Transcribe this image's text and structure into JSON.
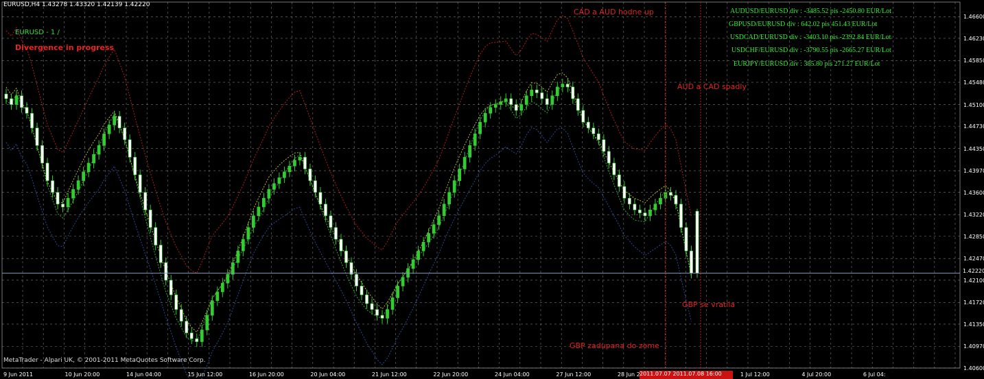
{
  "header": {
    "text": "EURUSD,H4  1.43278 1.43320 1.42139 1.42220"
  },
  "indicator": {
    "symbol_label": "EURUSD - 1 / ",
    "status": "Divergence in progress",
    "lines": [
      "AUDUSD/EURUSD div : -3485.52 pis -2450.80 EUR/Lot",
      "GBPUSD/EURUSD div : 642.02 pis 451.43 EUR/Lot",
      "USDCAD/EURUSD div : -3403.10 pis -2392.84 EUR/Lot",
      "USDCHF/EURUSD div : -3790.55 pis -2665.27 EUR/Lot",
      "EURJPY/EURUSD div : 385.80 pis 271.27 EUR/Lot"
    ]
  },
  "annotations": {
    "cad_aud_up": "CAD a AUD hodne up",
    "aud_cad_down": "AUD a CAD spadly",
    "gbp_back": "GBP se vratila",
    "gbp_down": "GBP zadupana do zeme"
  },
  "copyright": "MetaTrader - Alpari UK, © 2001-2011 MetaQuotes Software Corp.",
  "y_axis": [
    "1.46600",
    "1.46230",
    "1.45850",
    "1.45480",
    "1.45100",
    "1.44730",
    "1.44350",
    "1.43970",
    "1.43600",
    "1.43220",
    "1.42850",
    "1.42470",
    "1.42100",
    "1.41720",
    "1.41350",
    "1.40970",
    "1.40600"
  ],
  "current_price": "1.42220",
  "x_axis": [
    "9 Jun 2011",
    "10 Jun 20:00",
    "14 Jun 04:00",
    "15 Jun 12:00",
    "16 Jun 20:00",
    "20 Jun 04:00",
    "21 Jun 12:00",
    "22 Jun 20:00",
    "24 Jun 04:00",
    "27 Jun 12:00",
    "28 Jun 20:00",
    "30 Jun 04:00",
    "1 Jul 12:00",
    "4 Jul 20:00",
    "6 Jul 04:"
  ],
  "time_box": "2011.07.07 2011.07.08 16:00",
  "colors": {
    "background": "#000000",
    "grid": "#aaaaaa",
    "bull": "#ffffff",
    "bear": "#33cc33",
    "candle_border": "#33cc33",
    "div_text": "#33ee33",
    "annotation": "#dd2222",
    "price_line": "#8899bb"
  },
  "chart_data": {
    "type": "candlestick",
    "symbol": "EURUSD",
    "timeframe": "H4",
    "ylim": [
      1.406,
      1.4685
    ],
    "last": {
      "open": 1.43278,
      "high": 1.4332,
      "low": 1.42139,
      "close": 1.4222
    },
    "closes": [
      1.452,
      1.451,
      1.4525,
      1.4505,
      1.4495,
      1.447,
      1.444,
      1.441,
      1.438,
      1.436,
      1.434,
      1.4335,
      1.435,
      1.4365,
      1.438,
      1.4395,
      1.441,
      1.4425,
      1.444,
      1.446,
      1.4475,
      1.449,
      1.447,
      1.445,
      1.442,
      1.439,
      1.436,
      1.433,
      1.43,
      1.427,
      1.424,
      1.421,
      1.4185,
      1.416,
      1.414,
      1.412,
      1.411,
      1.4105,
      1.4125,
      1.415,
      1.4175,
      1.419,
      1.4205,
      1.422,
      1.424,
      1.426,
      1.428,
      1.43,
      1.432,
      1.4335,
      1.435,
      1.4365,
      1.4375,
      1.4385,
      1.4395,
      1.4405,
      1.4415,
      1.442,
      1.44,
      1.438,
      1.436,
      1.434,
      1.432,
      1.43,
      1.428,
      1.426,
      1.424,
      1.422,
      1.42,
      1.4185,
      1.417,
      1.416,
      1.415,
      1.4145,
      1.416,
      1.418,
      1.42,
      1.4215,
      1.423,
      1.4245,
      1.426,
      1.4275,
      1.429,
      1.4305,
      1.432,
      1.434,
      1.436,
      1.438,
      1.44,
      1.442,
      1.444,
      1.446,
      1.448,
      1.4495,
      1.4505,
      1.451,
      1.4515,
      1.452,
      1.451,
      1.45,
      1.451,
      1.4525,
      1.4535,
      1.453,
      1.452,
      1.451,
      1.4525,
      1.454,
      1.4545,
      1.454,
      1.452,
      1.45,
      1.448,
      1.447,
      1.446,
      1.445,
      1.443,
      1.441,
      1.439,
      1.437,
      1.435,
      1.434,
      1.433,
      1.4325,
      1.432,
      1.433,
      1.434,
      1.435,
      1.436,
      1.4355,
      1.434,
      1.43,
      1.426,
      1.4222
    ]
  }
}
